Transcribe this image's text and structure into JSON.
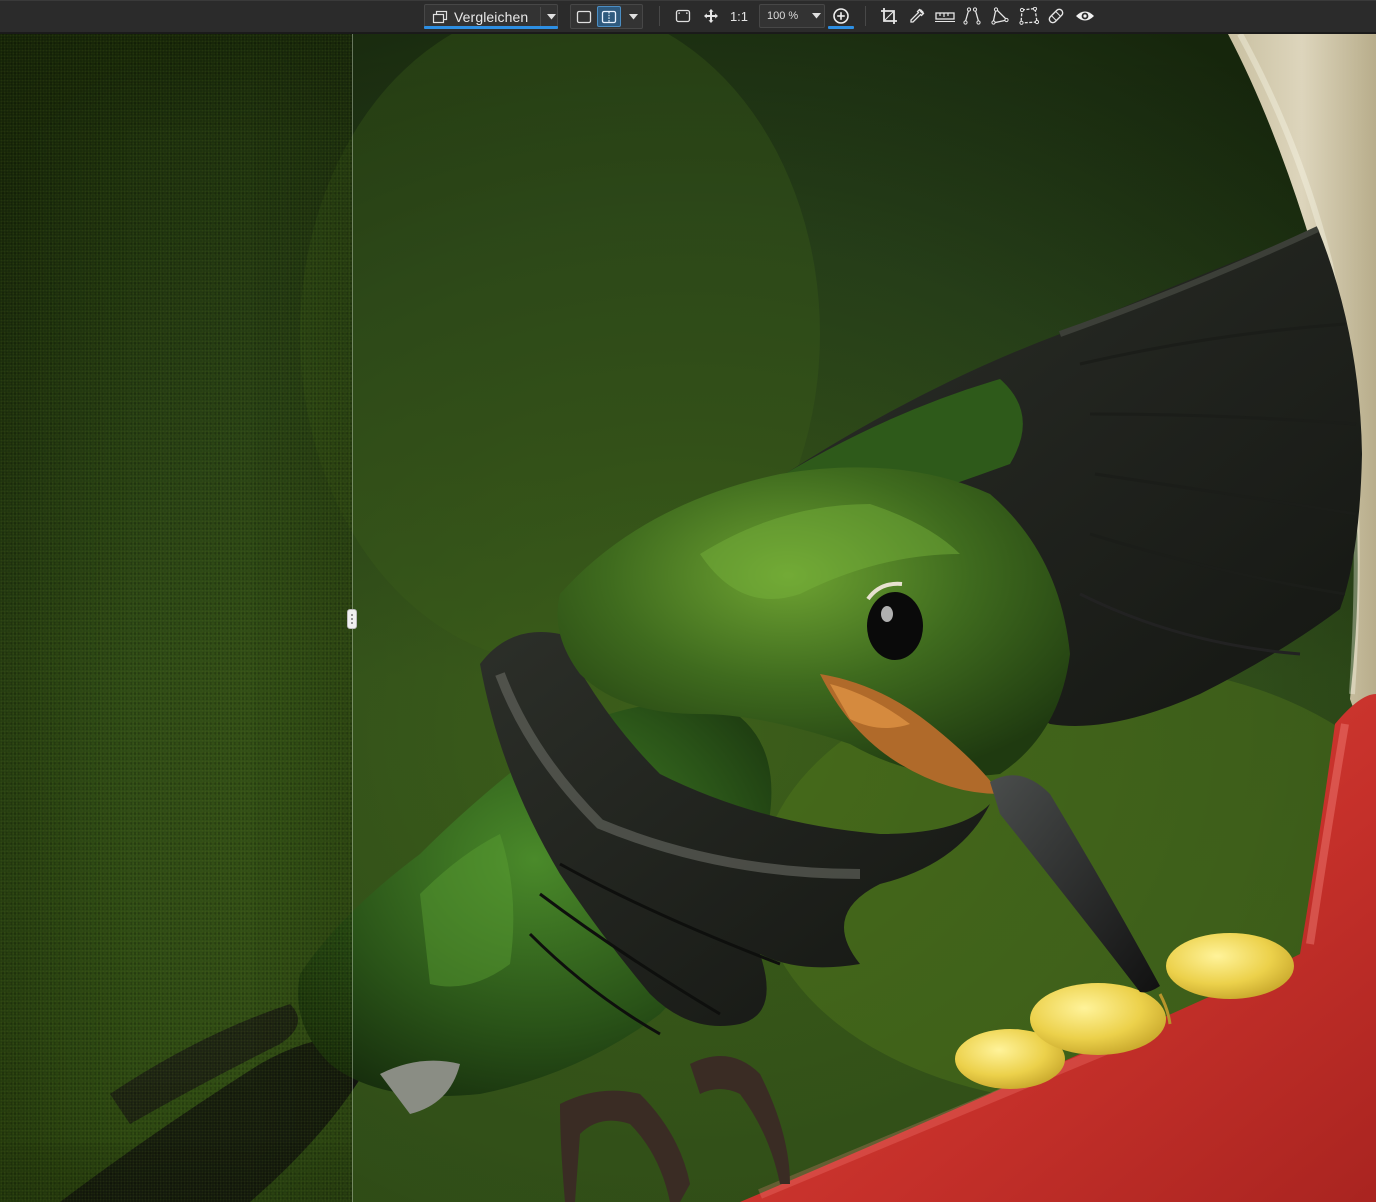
{
  "toolbar": {
    "compare": {
      "label": "Vergleichen",
      "icon": "compare-windows-icon",
      "dropdown_icon": "chevron-down-icon"
    },
    "view_modes": [
      {
        "name": "single-view",
        "icon": "single-view-icon",
        "active": false
      },
      {
        "name": "split-view",
        "icon": "split-view-icon",
        "active": true
      }
    ],
    "fit_icon": "fit-to-screen-icon",
    "pan_icon": "pan-move-icon",
    "one_to_one_label": "1:1",
    "zoom": {
      "value": "100 %",
      "options_icon": "chevron-down-icon"
    },
    "zoom_in_icon": "zoom-in-icon",
    "tools": [
      "crop-icon",
      "eyedropper-icon",
      "straighten-icon",
      "perspective-vertical-icon",
      "perspective-horizontal-icon",
      "perspective-free-icon",
      "healing-icon",
      "preview-eye-icon"
    ],
    "accent_color": "#2d8fe3"
  },
  "canvas": {
    "mode": "split-comparison",
    "before_side": "left",
    "after_side": "right",
    "subject": "hummingbird at red feeder"
  }
}
